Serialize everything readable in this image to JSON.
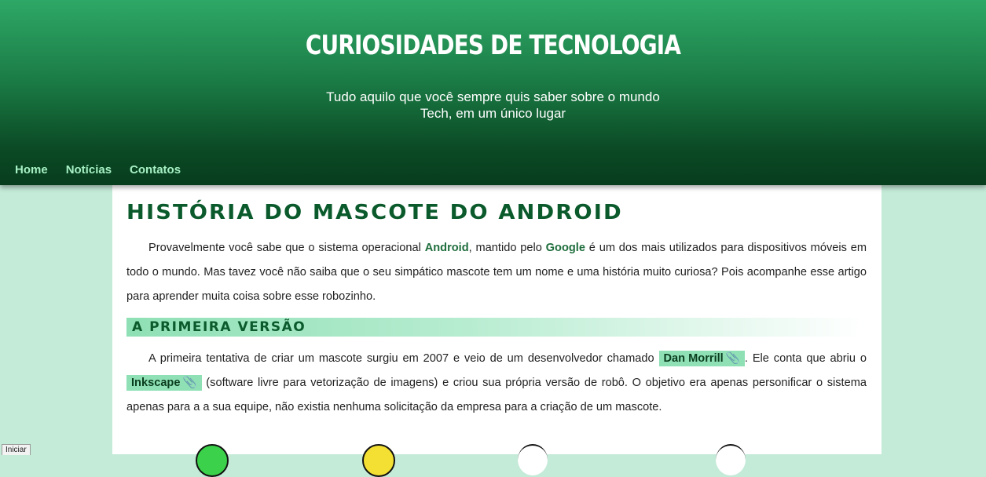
{
  "header": {
    "site_title": "CURIOSIDADES DE TECNOLOGIA",
    "subtitle_line1": "Tudo aquilo que você sempre quis saber sobre o mundo",
    "subtitle_line2": "Tech, em um único lugar"
  },
  "nav": {
    "items": [
      {
        "label": "Home"
      },
      {
        "label": "Notícias"
      },
      {
        "label": "Contatos"
      }
    ]
  },
  "article": {
    "title": "História do mascote do Android",
    "intro": {
      "t1": "Provavelmente você sabe que o sistema operacional ",
      "h1": "Android",
      "t2": ", mantido pelo ",
      "h2": "Google",
      "t3": " é um dos mais utilizados para dispositivos móveis em todo o mundo. Mas tavez você não saiba que o seu simpático mascote tem um nome e uma história muito curiosa? Pois acompanhe esse artigo para aprender muita coisa sobre esse robozinho."
    },
    "section": {
      "title": "A primeira versão",
      "t1": "A primeira tentativa de criar um mascote surgiu em 2007 e veio de um desenvolvedor chamado ",
      "link1": "Dan Morrill",
      "t2": ". Ele conta que abriu o ",
      "link2": "Inkscape",
      "t3": " (software livre para vetorização de imagens) e criou sua própria versão de robô. O objetivo era apenas personificar o sistema apenas para a a sua equipe, não existia nenhuma solicitação da empresa para a criação de um mascote."
    },
    "link_icon": "paperclip-icon",
    "figures": [
      {
        "name": "green-android-figure",
        "color": "#3bd14a"
      },
      {
        "name": "yellow-android-figure",
        "color": "#f3e033"
      },
      {
        "name": "outline-android-figure",
        "color": "#ffffff"
      },
      {
        "name": "outline-android-figure-2",
        "color": "#ffffff"
      }
    ]
  },
  "status": {
    "text": "Iniciar"
  },
  "colors": {
    "header_top": "#2ea866",
    "header_bottom": "#073d1d",
    "page_bg": "#c4ead8",
    "nav_link": "#a6f0c4",
    "accent": "#8fe0b5",
    "title": "#0a5a2c"
  }
}
